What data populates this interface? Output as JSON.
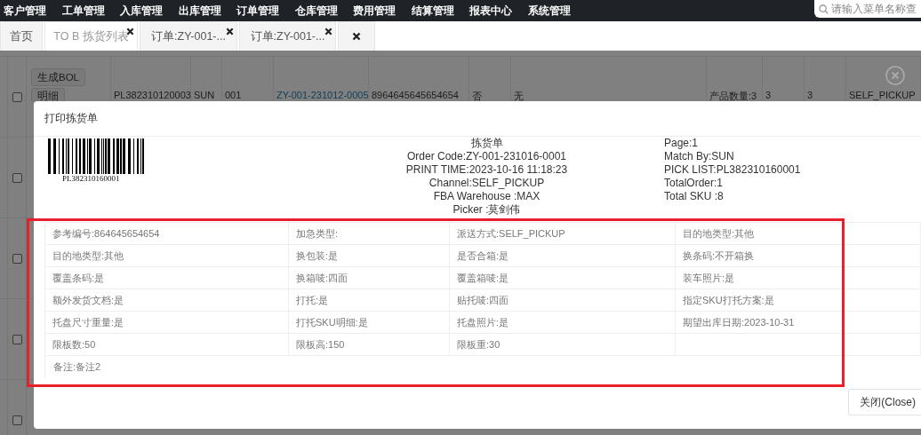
{
  "top_nav": {
    "menu": [
      "客户管理",
      "工单管理",
      "入库管理",
      "出库管理",
      "订单管理",
      "仓库管理",
      "费用管理",
      "结算管理",
      "报表中心",
      "系统管理"
    ],
    "search": {
      "placeholder": "请输入菜单名称查"
    }
  },
  "tabs": [
    {
      "label": "首页",
      "selected": false,
      "closable": false,
      "kind": "page"
    },
    {
      "label": "TO B 拣货列表",
      "selected": true,
      "closable": true,
      "kind": "page"
    },
    {
      "label": "订单:ZY-001-...",
      "selected": false,
      "closable": true,
      "kind": "page"
    },
    {
      "label": "订单:ZY-001-...",
      "selected": false,
      "closable": true,
      "kind": "page"
    },
    {
      "kind": "close-all"
    }
  ],
  "list_table": {
    "rows": [
      {
        "checked": false,
        "buttons": [
          "生成BOL",
          "明细"
        ],
        "cells": [
          {
            "text": "PL382310120003",
            "kind": "text"
          },
          {
            "text": "SUN",
            "kind": "text"
          },
          {
            "text": "001",
            "kind": "text"
          },
          {
            "text": "ZY-001-231012-0005",
            "kind": "link"
          },
          {
            "text": "8964645645654654",
            "kind": "text"
          },
          {
            "text": "否",
            "kind": "text"
          },
          {
            "text": "无",
            "kind": "text"
          },
          {
            "text": "产品数量:3",
            "kind": "text"
          },
          {
            "text": "3",
            "kind": "text"
          },
          {
            "text": "3",
            "kind": "text"
          },
          {
            "text": "SELF_PICKUP",
            "kind": "text"
          }
        ]
      },
      {
        "checked": false
      },
      {
        "checked": false
      },
      {
        "checked": false
      },
      {
        "checked": false
      }
    ]
  },
  "dialog": {
    "title": "打印拣货单",
    "barcode_text": "PL382310160001",
    "center_lines": [
      "拣货单",
      "Order Code:ZY-001-231016-0001",
      "PRINT TIME:2023-10-16 11:18:23",
      "Channel:SELF_PICKUP",
      "FBA Warehouse :MAX",
      "Picker :莫剑伟"
    ],
    "right_lines": [
      "Page:1",
      "Match By:SUN",
      "PICK LIST:PL382310160001",
      "TotalOrder:1",
      "Total SKU :8"
    ],
    "details": {
      "rows": [
        [
          "参考编号:864645654654",
          "加急类型:",
          "派送方式:SELF_PICKUP",
          "目的地类型:其他"
        ],
        [
          "目的地类型:其他",
          "换包装:是",
          "是否合箱:是",
          "换条码:不开箱换"
        ],
        [
          "覆盖条码:是",
          "换箱唛:四面",
          "覆盖箱唛:是",
          "装车照片:是"
        ],
        [
          "额外发货文档:是",
          "打托:是",
          "贴托唛:四面",
          "指定SKU打托方案:是"
        ],
        [
          "托盘尺寸重量:是",
          "打托SKU明细:是",
          "托盘照片:是",
          "期望出库日期:2023-10-31"
        ],
        [
          "限板数:50",
          "限板高:150",
          "限板重:30"
        ]
      ],
      "remark": "备注:备注2"
    },
    "buttons": [
      "关闭(Close)"
    ]
  }
}
